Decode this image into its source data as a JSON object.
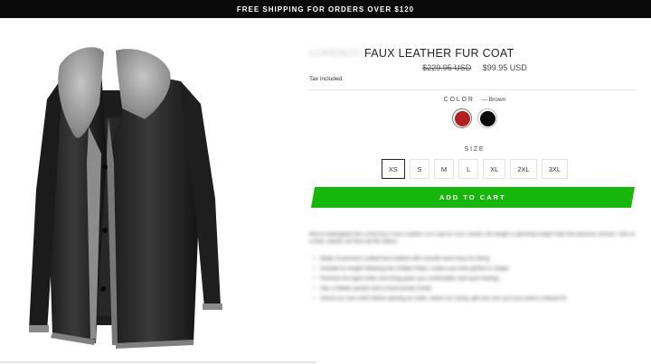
{
  "announcement": "FREE SHIPPING FOR ORDERS OVER $120",
  "product": {
    "brand": "LORENZO",
    "title": "FAUX LEATHER FUR COAT",
    "price_original": "$229.95 USD",
    "price_sale": "$99.95 USD",
    "tax_note": "Tax included."
  },
  "color_option": {
    "label": "COLOR",
    "selected": "— Brown",
    "swatches": [
      {
        "name": "Brown",
        "color": "#b32020"
      },
      {
        "name": "Black",
        "color": "#0b0b0b"
      }
    ]
  },
  "size_option": {
    "label": "SIZE",
    "selected": "XS",
    "sizes": [
      "XS",
      "S",
      "M",
      "L",
      "XL",
      "2XL",
      "3XL"
    ]
  },
  "add_to_cart": "ADD TO CART",
  "add_to_cart_color": "#17b60a",
  "description": {
    "intro": "We've redesigned the LORENZO Faux Leather Fur Coat for 2021 winter, the length is perfectly longer than the previous version. One of a kind, stands out from all the others.",
    "bullets": [
      "Made of premium crafted faux leather with smooth warm faux fur lining",
      "Outside fur length following the Golden Ratio, makes you look perfect in shape",
      "Premium fur lapel collar and lining gives you comfortable and warm feeling",
      "Has a hidden pocket and a hand pocket inside",
      "Check our size chart before placing an order, check our sizing, get one size up if you need a relaxed fit."
    ]
  }
}
